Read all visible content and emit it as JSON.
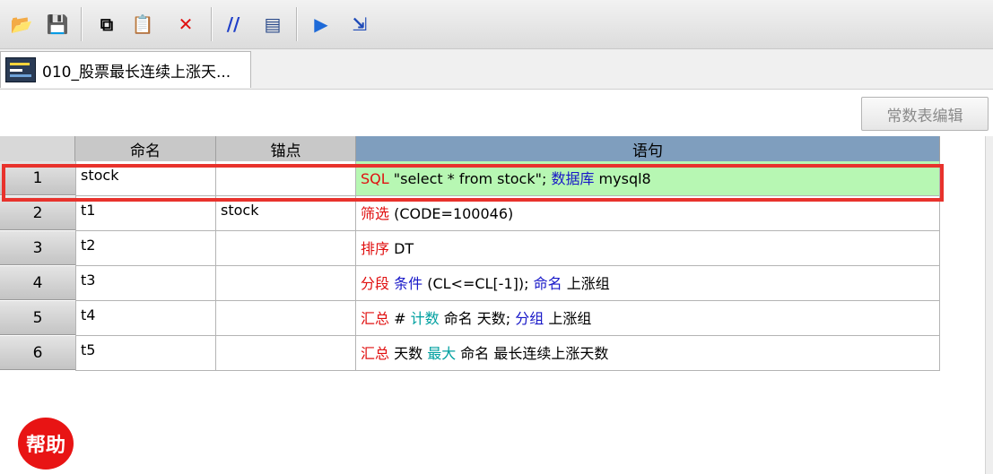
{
  "toolbar": {
    "buttons": [
      {
        "name": "open-icon",
        "glyph": "📂"
      },
      {
        "name": "save-icon",
        "glyph": "💾"
      },
      {
        "name": "copy-icon",
        "glyph": "⧉"
      },
      {
        "name": "paste-icon",
        "glyph": "📋"
      },
      {
        "name": "delete-icon",
        "glyph": "✕",
        "color": "#e01010"
      },
      {
        "name": "comment-icon",
        "glyph": "//",
        "color": "#1e3ec8"
      },
      {
        "name": "grid-icon",
        "glyph": "▤",
        "color": "#2a4a8a"
      },
      {
        "name": "run-icon",
        "glyph": "▶",
        "color": "#1e6ad8"
      },
      {
        "name": "step-run-icon",
        "glyph": "⇲",
        "color": "#1e4ab8"
      }
    ]
  },
  "tab": {
    "label": "010_股票最长连续上涨天..."
  },
  "const_button": "常数表编辑",
  "grid": {
    "headers": {
      "name": "命名",
      "anchor": "锚点",
      "statement": "语句"
    },
    "rows": [
      {
        "num": "1",
        "name": "stock",
        "anchor": "",
        "statement": [
          {
            "t": "SQL",
            "c": "kw-red"
          },
          {
            "t": " \"select * from stock\"; ",
            "c": "plain"
          },
          {
            "t": "数据库",
            "c": "kw-blue"
          },
          {
            "t": " mysql8",
            "c": "plain"
          }
        ]
      },
      {
        "num": "2",
        "name": "t1",
        "anchor": "stock",
        "statement": [
          {
            "t": "筛选",
            "c": "kw-red"
          },
          {
            "t": " (CODE=100046)",
            "c": "plain"
          }
        ]
      },
      {
        "num": "3",
        "name": "t2",
        "anchor": "",
        "statement": [
          {
            "t": "排序",
            "c": "kw-red"
          },
          {
            "t": " DT",
            "c": "plain"
          }
        ]
      },
      {
        "num": "4",
        "name": "t3",
        "anchor": "",
        "statement": [
          {
            "t": "分段",
            "c": "kw-red"
          },
          {
            "t": " ",
            "c": "plain"
          },
          {
            "t": "条件",
            "c": "kw-blue"
          },
          {
            "t": " (CL<=CL[-1]); ",
            "c": "plain"
          },
          {
            "t": "命名",
            "c": "kw-blue"
          },
          {
            "t": " 上涨组",
            "c": "plain"
          }
        ]
      },
      {
        "num": "5",
        "name": "t4",
        "anchor": "",
        "statement": [
          {
            "t": "汇总",
            "c": "kw-red"
          },
          {
            "t": " # ",
            "c": "plain"
          },
          {
            "t": "计数",
            "c": "kw-teal"
          },
          {
            "t": " 命名 天数; ",
            "c": "plain"
          },
          {
            "t": "分组",
            "c": "kw-blue"
          },
          {
            "t": " 上涨组",
            "c": "plain"
          }
        ]
      },
      {
        "num": "6",
        "name": "t5",
        "anchor": "",
        "statement": [
          {
            "t": "汇总",
            "c": "kw-red"
          },
          {
            "t": " 天数 ",
            "c": "plain"
          },
          {
            "t": "最大",
            "c": "kw-teal"
          },
          {
            "t": " 命名 最长连续上涨天数",
            "c": "plain"
          }
        ]
      }
    ],
    "highlighted_row": "1"
  },
  "help": {
    "label": "帮助"
  },
  "colors": {
    "highlight": "#e8322c",
    "selected_row": "#b7f7b3",
    "header_statement": "#7f9ebe"
  }
}
